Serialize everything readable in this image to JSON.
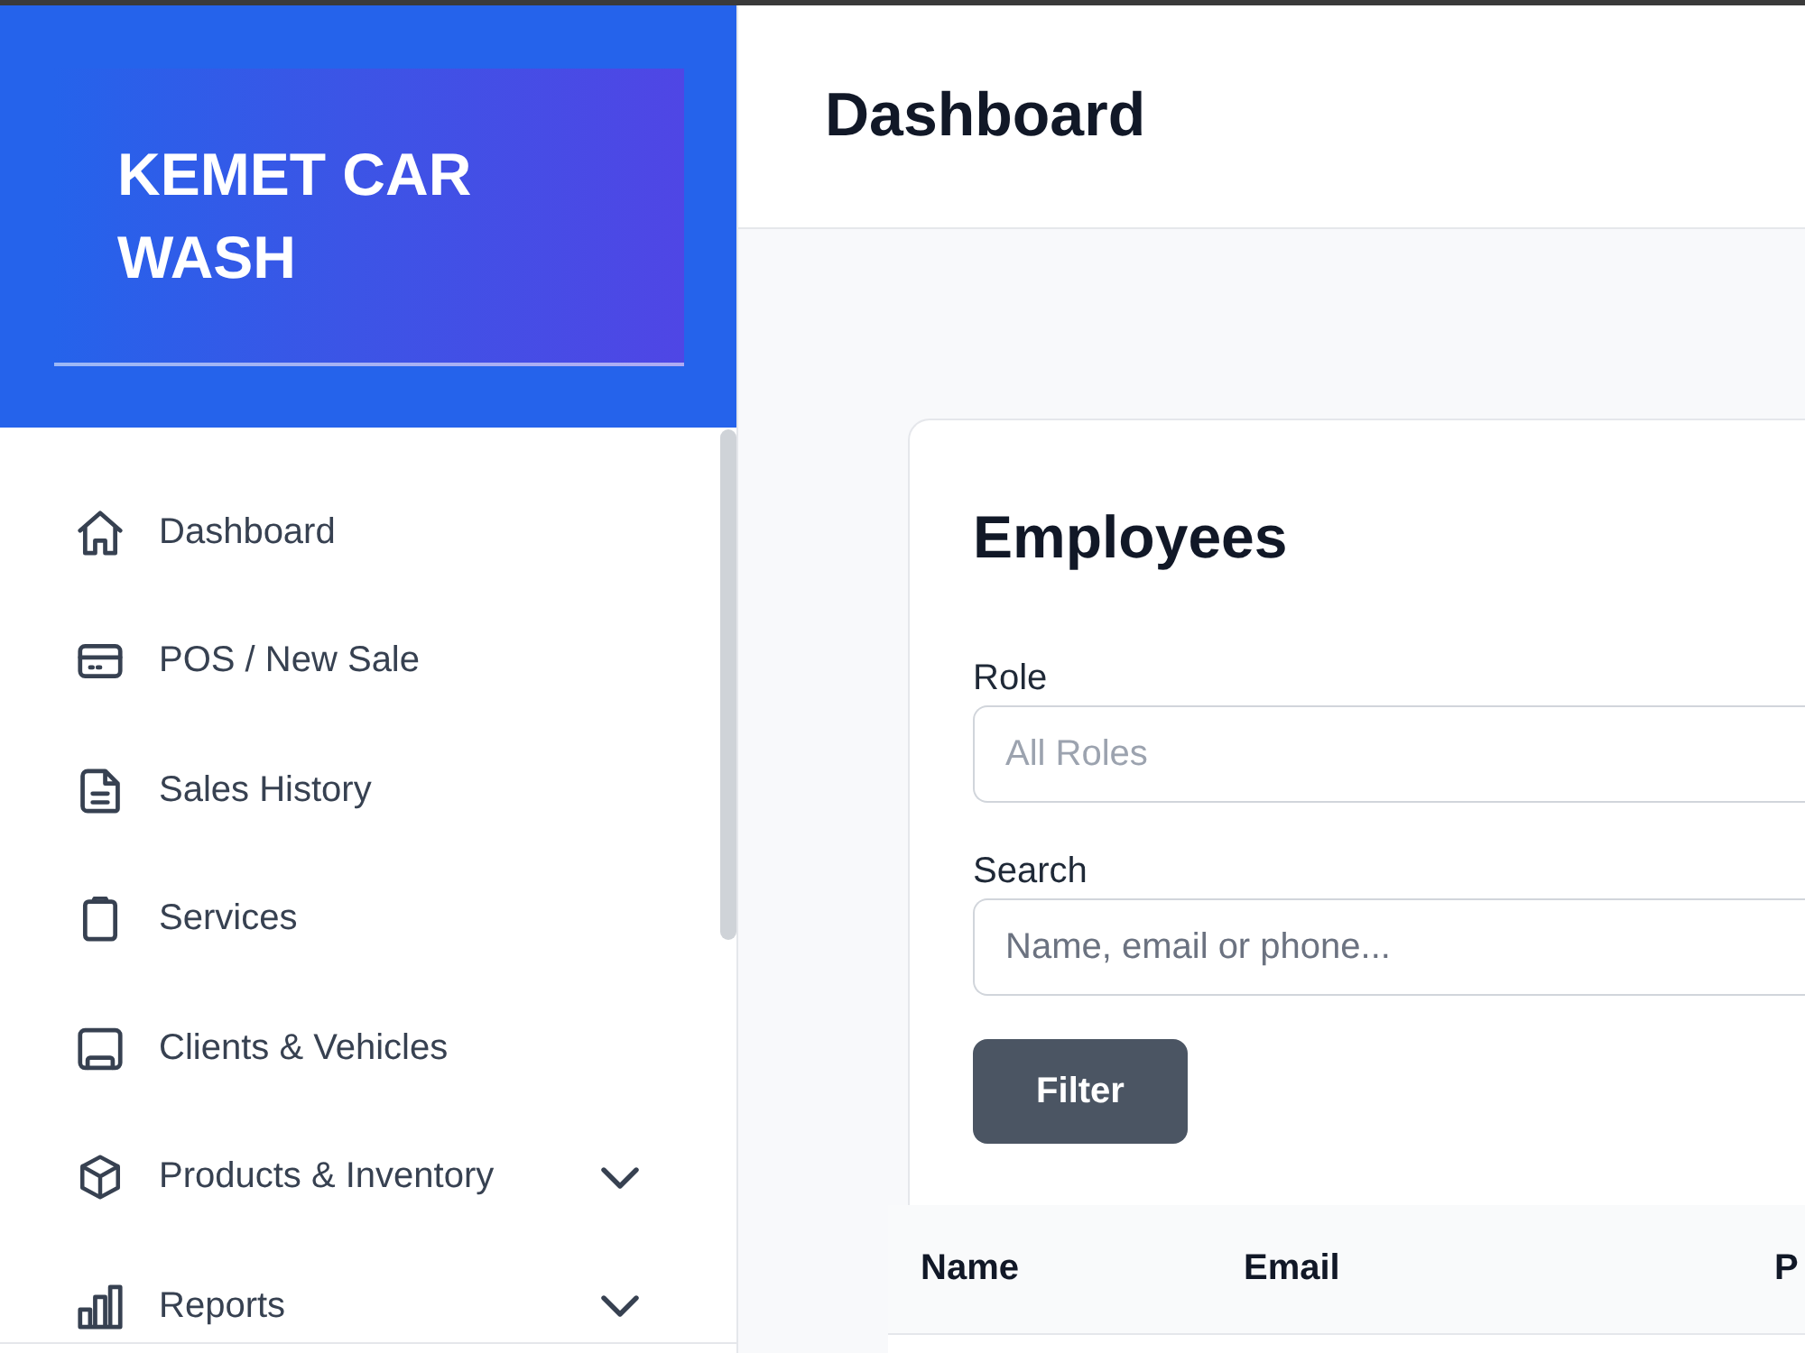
{
  "sidebar": {
    "brand": "KEMET CAR WASH",
    "nav_items": [
      {
        "label": "Dashboard",
        "kind": "link"
      },
      {
        "label": "POS / New Sale",
        "kind": "link"
      },
      {
        "label": "Sales History",
        "kind": "link"
      },
      {
        "label": "Services",
        "kind": "link"
      },
      {
        "label": "Clients & Vehicles",
        "kind": "link"
      },
      {
        "label": "Products & Inventory",
        "kind": "group",
        "expanded": false
      },
      {
        "label": "Reports",
        "kind": "group",
        "expanded": false
      }
    ]
  },
  "header": {
    "title": "Dashboard"
  },
  "employees_card": {
    "title": "Employees",
    "filters": [
      {
        "label": "Role",
        "kind": "select",
        "placeholder": "All Roles"
      },
      {
        "label": "Search",
        "kind": "text",
        "placeholder": "Name, email or phone..."
      }
    ],
    "button": "Filter"
  },
  "table": {
    "columns": [
      "Name",
      "Email",
      "P"
    ]
  }
}
